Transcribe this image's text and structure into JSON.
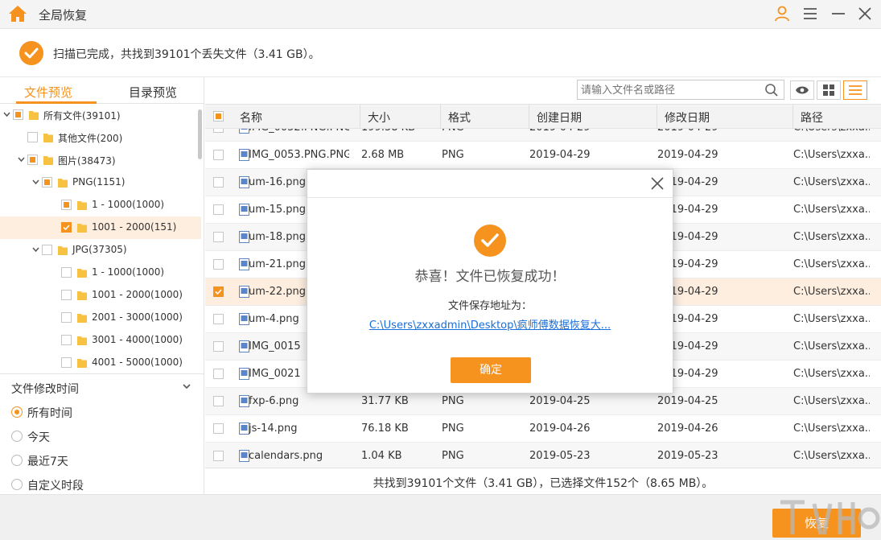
{
  "app": {
    "title": "全局恢复",
    "accent_color": "#f5931e"
  },
  "status": {
    "text": "扫描已完成，共找到39101个丢失文件（3.41 GB）。"
  },
  "left_tabs": [
    "文件预览",
    "目录预览"
  ],
  "tree": [
    {
      "label": "所有文件(39101)",
      "level": 0,
      "expanded": true,
      "check": "partial"
    },
    {
      "label": "其他文件(200)",
      "level": 1,
      "expanded": null,
      "check": "none"
    },
    {
      "label": "图片(38473)",
      "level": 1,
      "expanded": true,
      "check": "partial"
    },
    {
      "label": "PNG(1151)",
      "level": 2,
      "expanded": true,
      "check": "partial"
    },
    {
      "label": "1 - 1000(1000)",
      "level": 3,
      "expanded": null,
      "check": "partial"
    },
    {
      "label": "1001 - 2000(151)",
      "level": 3,
      "expanded": null,
      "check": "checked",
      "selected": true
    },
    {
      "label": "JPG(37305)",
      "level": 2,
      "expanded": true,
      "check": "none"
    },
    {
      "label": "1 - 1000(1000)",
      "level": 3,
      "expanded": null,
      "check": "none"
    },
    {
      "label": "1001 - 2000(1000)",
      "level": 3,
      "expanded": null,
      "check": "none"
    },
    {
      "label": "2001 - 3000(1000)",
      "level": 3,
      "expanded": null,
      "check": "none"
    },
    {
      "label": "3001 - 4000(1000)",
      "level": 3,
      "expanded": null,
      "check": "none"
    },
    {
      "label": "4001 - 5000(1000)",
      "level": 3,
      "expanded": null,
      "check": "none"
    }
  ],
  "filter": {
    "title": "文件修改时间",
    "options": [
      "所有时间",
      "今天",
      "最近7天",
      "自定义时段"
    ],
    "selected": 0
  },
  "search": {
    "placeholder": "请输入文件名或路径"
  },
  "table": {
    "columns": [
      "名称",
      "大小",
      "格式",
      "创建日期",
      "修改日期",
      "路径"
    ],
    "partial_row": {
      "name": "IMG_0052.PNG.PNG",
      "size": "199.58 KB",
      "format": "PNG",
      "created": "2019-04-29",
      "modified": "2019-04-29",
      "path": "C:\\Users\\zxxa..."
    },
    "rows": [
      {
        "name": "IMG_0053.PNG.PNG",
        "size": "2.68 MB",
        "format": "PNG",
        "created": "2019-04-29",
        "modified": "2019-04-29",
        "path": "C:\\Users\\zxxa...",
        "checked": false
      },
      {
        "name": "um-16.png",
        "size": "",
        "format": "",
        "created": "",
        "modified": "2019-04-29",
        "path": "C:\\Users\\zxxa...",
        "checked": false
      },
      {
        "name": "um-15.png",
        "size": "",
        "format": "",
        "created": "",
        "modified": "2019-04-29",
        "path": "C:\\Users\\zxxa...",
        "checked": false
      },
      {
        "name": "um-18.png",
        "size": "",
        "format": "",
        "created": "",
        "modified": "2019-04-29",
        "path": "C:\\Users\\zxxa...",
        "checked": false
      },
      {
        "name": "um-21.png",
        "size": "",
        "format": "",
        "created": "",
        "modified": "2019-04-29",
        "path": "C:\\Users\\zxxa...",
        "checked": false
      },
      {
        "name": "um-22.png",
        "size": "",
        "format": "",
        "created": "",
        "modified": "2019-04-29",
        "path": "C:\\Users\\zxxa...",
        "checked": true
      },
      {
        "name": "um-4.png",
        "size": "",
        "format": "",
        "created": "",
        "modified": "2019-04-29",
        "path": "C:\\Users\\zxxa...",
        "checked": false
      },
      {
        "name": "IMG_0015",
        "size": "",
        "format": "",
        "created": "",
        "modified": "2019-04-29",
        "path": "C:\\Users\\zxxa...",
        "checked": false
      },
      {
        "name": "IMG_0021",
        "size": "",
        "format": "",
        "created": "",
        "modified": "2019-04-29",
        "path": "C:\\Users\\zxxa...",
        "checked": false
      },
      {
        "name": "fxp-6.png",
        "size": "31.77 KB",
        "format": "PNG",
        "created": "2019-04-25",
        "modified": "2019-04-25",
        "path": "C:\\Users\\zxxa...",
        "checked": false
      },
      {
        "name": "js-14.png",
        "size": "76.18 KB",
        "format": "PNG",
        "created": "2019-04-26",
        "modified": "2019-04-26",
        "path": "C:\\Users\\zxxa...",
        "checked": false
      },
      {
        "name": "calendars.png",
        "size": "1.04 KB",
        "format": "PNG",
        "created": "2019-05-23",
        "modified": "2019-05-23",
        "path": "C:\\Users\\zxxa...",
        "checked": false
      }
    ]
  },
  "summary": "共找到39101个文件（3.41 GB），已选择文件152个（8.65 MB）。",
  "recover_button": "恢复",
  "modal": {
    "message": "恭喜！文件已恢复成功！",
    "path_label": "文件保存地址为：",
    "path_link": "C:\\Users\\zxxadmin\\Desktop\\疯师傅数据恢复大...",
    "confirm": "确定"
  }
}
